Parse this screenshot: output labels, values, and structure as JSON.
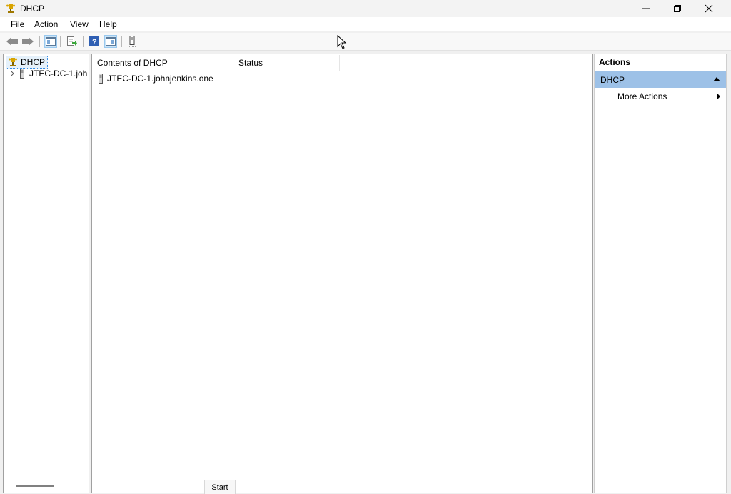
{
  "window": {
    "title": "DHCP"
  },
  "menu": [
    "File",
    "Action",
    "View",
    "Help"
  ],
  "toolbar": {
    "icons": [
      "back-icon",
      "forward-icon",
      "show-hide-console-tree-icon",
      "export-list-icon",
      "help-icon",
      "show-hide-action-pane-icon",
      "server-icon"
    ]
  },
  "tree": {
    "root_label": "DHCP",
    "child_label": "JTEC-DC-1.joh"
  },
  "content": {
    "columns": [
      "Contents of DHCP",
      "Status"
    ],
    "rows": [
      {
        "name": "JTEC-DC-1.johnjenkins.one",
        "status": ""
      }
    ]
  },
  "actions": {
    "title": "Actions",
    "section": "DHCP",
    "items": [
      "More Actions"
    ]
  },
  "start_tab": "Start",
  "colors": {
    "accent_selected": "#9dc1e7",
    "tree_selected": "#e5f1fb"
  }
}
